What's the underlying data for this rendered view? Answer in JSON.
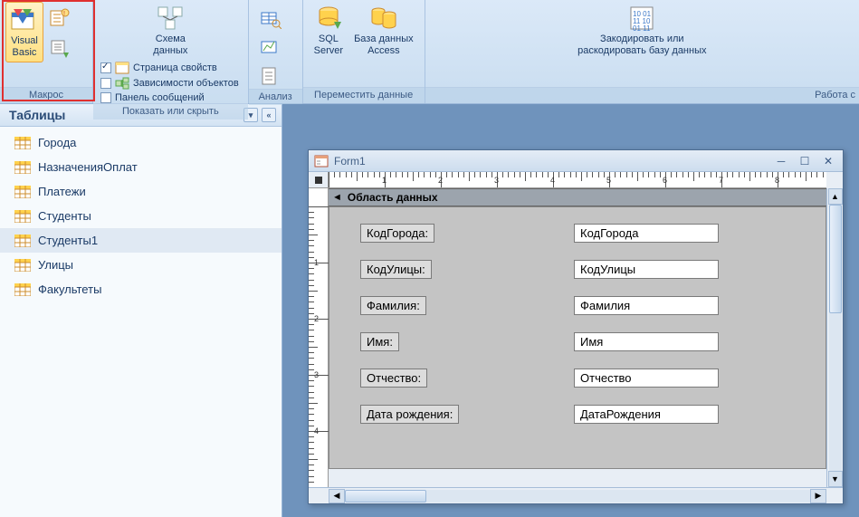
{
  "ribbon": {
    "macro": {
      "vb_label": "Visual\nBasic",
      "group": "Макрос"
    },
    "schema_label": "Схема\nданных",
    "show_hide": {
      "prop_page": "Страница свойств",
      "obj_deps": "Зависимости объектов",
      "msg_panel": "Панель сообщений",
      "group": "Показать или скрыть"
    },
    "analysis_group": "Анализ",
    "sql_label": "SQL\nServer",
    "access_label": "База данных\nAccess",
    "move_group": "Переместить данные",
    "encode_label": "Закодировать или\nраскодировать базу данных",
    "work_group": "Работа с"
  },
  "nav": {
    "header": "Таблицы",
    "items": [
      "Города",
      "НазначенияОплат",
      "Платежи",
      "Студенты",
      "Студенты1",
      "Улицы",
      "Факультеты"
    ],
    "selected_index": 4
  },
  "form_window": {
    "title": "Form1",
    "section_header": "Область данных",
    "fields": [
      {
        "label": "КодГорода:",
        "value": "КодГорода"
      },
      {
        "label": "КодУлицы:",
        "value": "КодУлицы"
      },
      {
        "label": "Фамилия:",
        "value": "Фамилия"
      },
      {
        "label": "Имя:",
        "value": "Имя"
      },
      {
        "label": "Отчество:",
        "value": "Отчество"
      },
      {
        "label": "Дата рождения:",
        "value": "ДатаРождения"
      }
    ]
  }
}
